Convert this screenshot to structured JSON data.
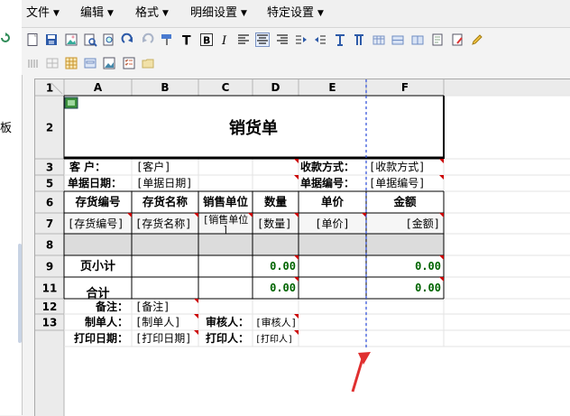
{
  "menu": [
    {
      "label": "文件"
    },
    {
      "label": "编辑"
    },
    {
      "label": "格式"
    },
    {
      "label": "明细设置"
    },
    {
      "label": "特定设置"
    }
  ],
  "left_panel": {
    "text": "板"
  },
  "toolbar1_icons": [
    "new-icon",
    "save-icon",
    "image-icon",
    "print-preview-icon",
    "find-icon",
    "redo-icon",
    "undo-icon",
    "format-painter-icon",
    "text-icon",
    "bold-icon",
    "italic-icon",
    "align-left-icon",
    "align-center-icon",
    "align-right-icon",
    "indent-icon",
    "outdent-icon",
    "column-split-icon",
    "column-insert-icon",
    "table-icon",
    "table-row-icon",
    "table-col-icon",
    "page-icon",
    "page-edit-icon",
    "pencil-icon"
  ],
  "toolbar2_icons": [
    "grid-columns-icon",
    "grid-cells-icon",
    "table-grid-icon",
    "form-icon",
    "picture-icon",
    "checklist-icon",
    "folder-icon"
  ],
  "columns": [
    "A",
    "B",
    "C",
    "D",
    "E",
    "F"
  ],
  "rows": [
    "1",
    "2",
    "3",
    "5",
    "6",
    "7",
    "8",
    "9",
    "11",
    "12",
    "13"
  ],
  "report": {
    "title": "销货单",
    "customer_label": "客    户：",
    "customer_value": "[客户]",
    "payment_label": "收款方式：",
    "payment_value": "[收款方式]",
    "date_label": "单据日期：",
    "date_value": "[单据日期]",
    "docno_label": "单据编号：",
    "docno_value": "[单据编号]",
    "headers": [
      "存货编号",
      "存货名称",
      "销售单位",
      "数量",
      "单价",
      "金额"
    ],
    "detail_fields": [
      "[存货编号]",
      "[存货名称]",
      "[销售单位]",
      "[数量]",
      "[单价]",
      "[金额]"
    ],
    "page_subtotal_label": "页小计",
    "page_subtotal_qty": "0.00",
    "page_subtotal_amount": "0.00",
    "total_label": "合计",
    "total_qty": "0.00",
    "total_amount": "0.00",
    "memo_label": "备注：",
    "memo_value": "[备注]",
    "maker_label": "制单人：",
    "maker_value": "[制单人]",
    "auditor_label": "审核人：",
    "auditor_value": "[审核人]",
    "printdate_label": "打印日期：",
    "printdate_value": "[打印日期]",
    "printer_label": "打印人：",
    "printer_value": "[打印人]"
  },
  "colors": {
    "amount_green": "#006400",
    "red_marker": "#cc0000",
    "guide_blue": "#2b4bd8",
    "arrow_red": "#e03030"
  }
}
